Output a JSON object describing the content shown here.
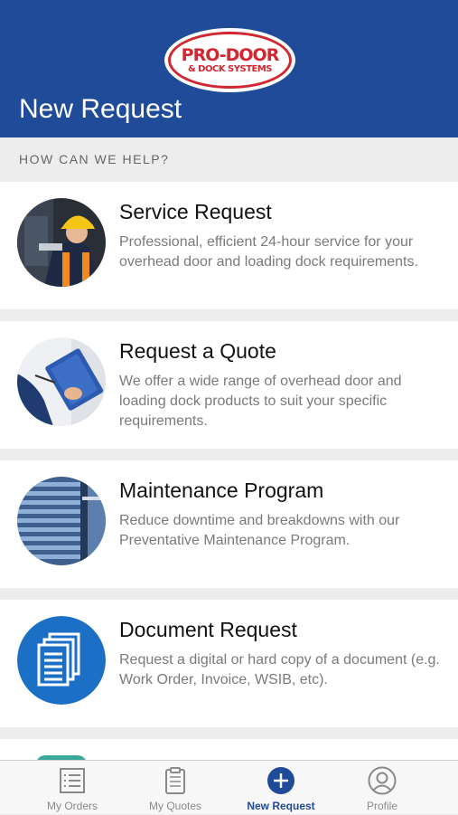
{
  "header": {
    "logo": {
      "line1": "PRO-DOOR",
      "line2": "& DOCK SYSTEMS"
    },
    "title": "New Request",
    "background": "#1f4b99",
    "logo_color": "#d22630"
  },
  "section_label": "HOW CAN WE HELP?",
  "cards": [
    {
      "title": "Service Request",
      "description": "Professional, efficient 24-hour service for your overhead door and loading dock requirements.",
      "icon": "technician-photo"
    },
    {
      "title": "Request a Quote",
      "description": "We offer a wide range of overhead door and loading dock products to suit your specific requirements.",
      "icon": "clipboard-photo"
    },
    {
      "title": "Maintenance Program",
      "description": "Reduce downtime and breakdowns with our Preventative Maintenance Program.",
      "icon": "overhead-door-photo"
    },
    {
      "title": "Document Request",
      "description": "Request a digital or hard copy of a document (e.g. Work Order, Invoice, WSIB, etc).",
      "icon": "documents-icon"
    }
  ],
  "tabbar": {
    "tabs": [
      {
        "label": "My Orders",
        "icon": "list-icon",
        "active": false
      },
      {
        "label": "My Quotes",
        "icon": "clipboard-icon",
        "active": false
      },
      {
        "label": "New Request",
        "icon": "plus-circle-icon",
        "active": true
      },
      {
        "label": "Profile",
        "icon": "user-icon",
        "active": false
      }
    ],
    "active_color": "#1f4b99"
  }
}
